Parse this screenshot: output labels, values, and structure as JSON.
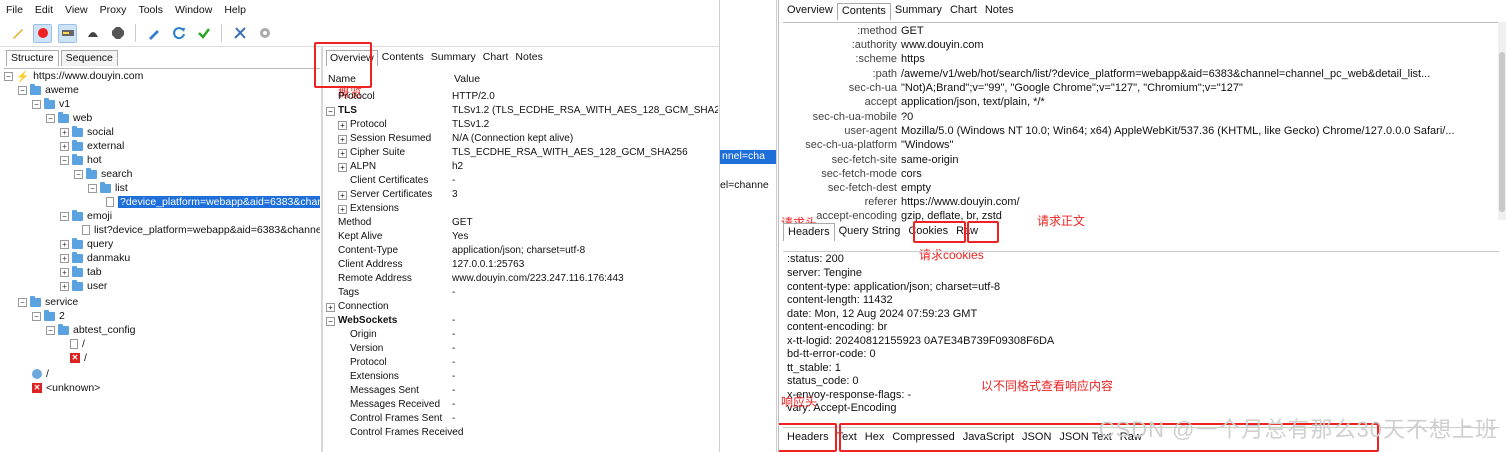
{
  "menubar": [
    "File",
    "Edit",
    "View",
    "Proxy",
    "Tools",
    "Window",
    "Help"
  ],
  "left_tabs": [
    "Structure",
    "Sequence"
  ],
  "tree": [
    {
      "label": "https://www.douyin.com",
      "icon": "bolt"
    },
    {
      "label": "aweme",
      "icon": "folder"
    },
    {
      "label": "v1",
      "icon": "folder"
    },
    {
      "label": "web",
      "icon": "folder"
    },
    {
      "label": "social",
      "icon": "folder"
    },
    {
      "label": "external",
      "icon": "folder"
    },
    {
      "label": "hot",
      "icon": "folder"
    },
    {
      "label": "search",
      "icon": "folder"
    },
    {
      "label": "list",
      "icon": "folder"
    },
    {
      "label": "?device_platform=webapp&aid=6383&channel=cha",
      "icon": "file"
    },
    {
      "label": "emoji",
      "icon": "folder"
    },
    {
      "label": "list?device_platform=webapp&aid=6383&channel=channe",
      "icon": "file"
    },
    {
      "label": "query",
      "icon": "folder"
    },
    {
      "label": "danmaku",
      "icon": "folder"
    },
    {
      "label": "tab",
      "icon": "folder"
    },
    {
      "label": "user",
      "icon": "folder"
    },
    {
      "label": "service",
      "icon": "folder"
    },
    {
      "label": "2",
      "icon": "folder"
    },
    {
      "label": "abtest_config",
      "icon": "folder"
    },
    {
      "label": "/",
      "icon": "file"
    },
    {
      "label": "/",
      "icon": "error"
    },
    {
      "label": "/",
      "icon": "globe"
    },
    {
      "label": "<unknown>",
      "icon": "error"
    }
  ],
  "detail_tabs": [
    "Overview",
    "Contents",
    "Summary",
    "Chart",
    "Notes"
  ],
  "overview": {
    "col_name": "Name",
    "col_value": "Value",
    "rows": [
      {
        "name": "Protocol",
        "value": "HTTP/2.0"
      },
      {
        "name": "TLS",
        "value": "TLSv1.2 (TLS_ECDHE_RSA_WITH_AES_128_GCM_SHA256)"
      },
      {
        "name": "Protocol",
        "value": "TLSv1.2"
      },
      {
        "name": "Session Resumed",
        "value": "N/A (Connection kept alive)"
      },
      {
        "name": "Cipher Suite",
        "value": "TLS_ECDHE_RSA_WITH_AES_128_GCM_SHA256"
      },
      {
        "name": "ALPN",
        "value": "h2"
      },
      {
        "name": "Client Certificates",
        "value": "-"
      },
      {
        "name": "Server Certificates",
        "value": "3"
      },
      {
        "name": "Extensions",
        "value": ""
      },
      {
        "name": "Method",
        "value": "GET"
      },
      {
        "name": "Kept Alive",
        "value": "Yes"
      },
      {
        "name": "Content-Type",
        "value": "application/json; charset=utf-8"
      },
      {
        "name": "Client Address",
        "value": "127.0.0.1:25763"
      },
      {
        "name": "Remote Address",
        "value": "www.douyin.com/223.247.116.176:443"
      },
      {
        "name": "Tags",
        "value": "-"
      },
      {
        "name": "Connection",
        "value": ""
      },
      {
        "name": "WebSockets",
        "value": "-"
      },
      {
        "name": "Origin",
        "value": "-"
      },
      {
        "name": "Version",
        "value": "-"
      },
      {
        "name": "Protocol",
        "value": "-"
      },
      {
        "name": "Extensions",
        "value": "-"
      },
      {
        "name": "Messages Sent",
        "value": "-"
      },
      {
        "name": "Messages Received",
        "value": "-"
      },
      {
        "name": "Control Frames Sent",
        "value": "-"
      },
      {
        "name": "Control Frames Received",
        "value": "-"
      }
    ]
  },
  "annotations": {
    "overview": "概览",
    "req_header": "请求头",
    "req_cookies": "请求cookies",
    "req_body": "请求正文",
    "resp_formats": "以不同格式查看响应内容",
    "resp_header": "响应头"
  },
  "mid_strip": {
    "selected": "nnel=cha",
    "row": "el=channe"
  },
  "right_tabs": [
    "Overview",
    "Contents",
    "Summary",
    "Chart",
    "Notes"
  ],
  "request_headers": [
    {
      "key": ":method",
      "value": "GET"
    },
    {
      "key": ":authority",
      "value": "www.douyin.com"
    },
    {
      "key": ":scheme",
      "value": "https"
    },
    {
      "key": ":path",
      "value": "/aweme/v1/web/hot/search/list/?device_platform=webapp&aid=6383&channel=channel_pc_web&detail_list..."
    },
    {
      "key": "sec-ch-ua",
      "value": "\"Not)A;Brand\";v=\"99\", \"Google Chrome\";v=\"127\", \"Chromium\";v=\"127\""
    },
    {
      "key": "accept",
      "value": "application/json, text/plain, */*"
    },
    {
      "key": "sec-ch-ua-mobile",
      "value": "?0"
    },
    {
      "key": "user-agent",
      "value": "Mozilla/5.0 (Windows NT 10.0; Win64; x64) AppleWebKit/537.36 (KHTML, like Gecko) Chrome/127.0.0.0 Safari/..."
    },
    {
      "key": "sec-ch-ua-platform",
      "value": "\"Windows\""
    },
    {
      "key": "sec-fetch-site",
      "value": "same-origin"
    },
    {
      "key": "sec-fetch-mode",
      "value": "cors"
    },
    {
      "key": "sec-fetch-dest",
      "value": "empty"
    },
    {
      "key": "referer",
      "value": "https://www.douyin.com/"
    },
    {
      "key": "accept-encoding",
      "value": "gzip, deflate, br, zstd"
    }
  ],
  "request_subtabs": [
    "Headers",
    "Query String",
    "Cookies",
    "Raw"
  ],
  "response_lines": [
    ":status: 200",
    "server: Tengine",
    "content-type: application/json; charset=utf-8",
    "content-length: 11432",
    "date: Mon, 12 Aug 2024 07:59:23 GMT",
    "content-encoding: br",
    "x-tt-logid: 20240812155923 0A7E34B739F09308F6DA",
    "bd-tt-error-code: 0",
    "tt_stable: 1",
    "status_code: 0",
    "x-envoy-response-flags: -",
    "vary: Accept-Encoding"
  ],
  "response_subtabs": [
    "Headers",
    "Text",
    "Hex",
    "Compressed",
    "JavaScript",
    "JSON",
    "JSON Text",
    "Raw"
  ],
  "watermark": "CSDN @一个月总有那么30天不想上班",
  "colors": {
    "annotation": "#e22222",
    "selection": "#1e6fd9"
  }
}
